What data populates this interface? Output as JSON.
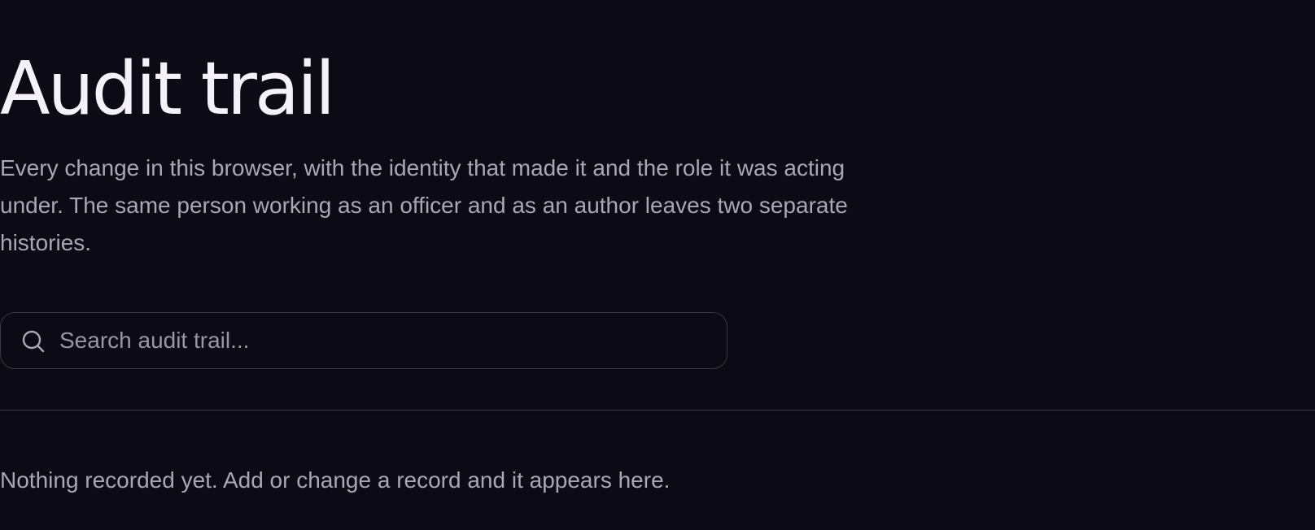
{
  "header": {
    "title": "Audit trail",
    "description": "Every change in this browser, with the identity that made it and the role it was acting under. The same person working as an officer and as an author leaves two separate histories."
  },
  "search": {
    "placeholder": "Search audit trail...",
    "value": "",
    "icon": "search-icon"
  },
  "audit_list": {
    "empty_message": "Nothing recorded yet. Add or change a record and it appears here."
  },
  "colors": {
    "background": "#0c0a14",
    "title": "#f4f2f8",
    "muted_text": "#aaa6b6",
    "border": "#3a3748"
  }
}
